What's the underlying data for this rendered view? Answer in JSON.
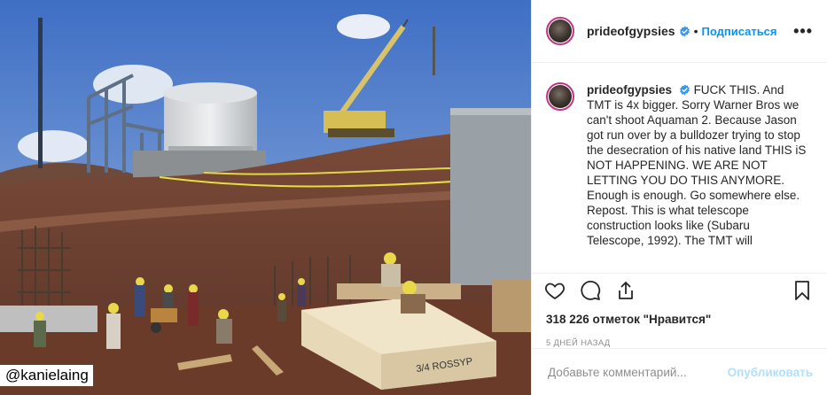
{
  "post": {
    "watermark": "@kanielaing",
    "sign_text": "3/4 ROSSYP"
  },
  "header": {
    "username": "prideofgypsies",
    "separator": "•",
    "follow_label": "Подписаться",
    "more_label": "•••"
  },
  "caption": {
    "username": "prideofgypsies",
    "text": "FUCK THIS. And TMT is 4x bigger. Sorry Warner Bros we can't shoot Aquaman 2. Because Jason got run over by a bulldozer trying to stop the desecration of his native land THIS iS NOT HAPPENING. WE ARE NOT LETTING YOU DO THIS ANYMORE. Enough is enough. Go somewhere else. Repost. This is what telescope construction looks like (Subaru Telescope, 1992). The TMT will"
  },
  "actions": {
    "like_icon": "heart-icon",
    "comment_icon": "comment-icon",
    "share_icon": "share-icon",
    "save_icon": "bookmark-icon"
  },
  "likes": "318 226 отметок \"Нравится\"",
  "date": "5 ДНЕЙ НАЗАД",
  "comment": {
    "placeholder": "Добавьте комментарий...",
    "publish_label": "Опубликовать"
  },
  "colors": {
    "accent": "#0095f6",
    "publish_disabled": "#b2dffc",
    "verified": "#3897f0",
    "avatar_ring": "#c13584"
  }
}
